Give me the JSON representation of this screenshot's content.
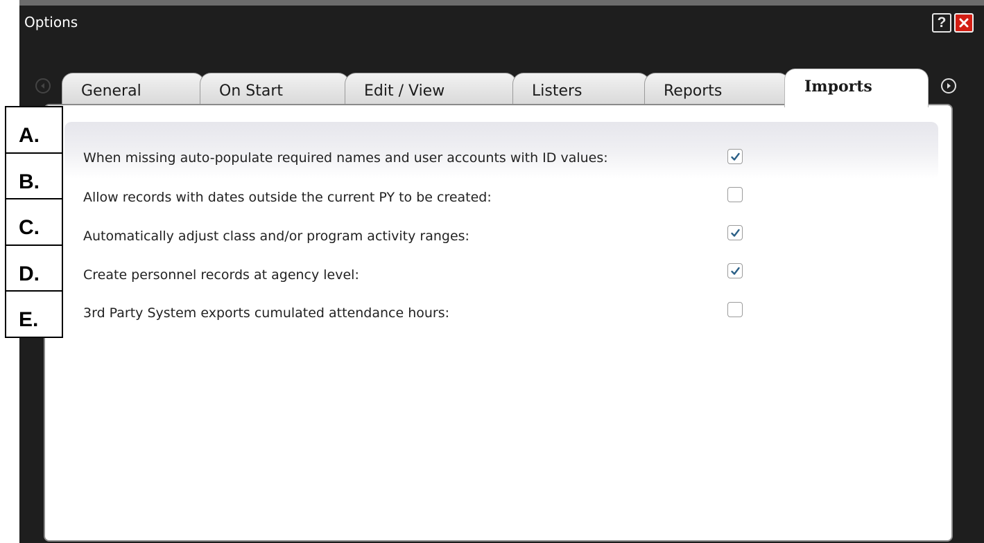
{
  "window": {
    "title": "Options",
    "help_label": "?"
  },
  "tabs": [
    {
      "label": "General",
      "active": false
    },
    {
      "label": "On Start",
      "active": false
    },
    {
      "label": "Edit / View",
      "active": false
    },
    {
      "label": "Listers",
      "active": false
    },
    {
      "label": "Reports",
      "active": false
    },
    {
      "label": "Imports",
      "active": true
    }
  ],
  "options": [
    {
      "letter": "A.",
      "label": "When missing auto-populate required names and user accounts with ID values:",
      "checked": true
    },
    {
      "letter": "B.",
      "label": "Allow records with dates outside the current PY to be created:",
      "checked": false
    },
    {
      "letter": "C.",
      "label": "Automatically adjust class and/or program activity ranges:",
      "checked": true
    },
    {
      "letter": "D.",
      "label": "Create personnel records at agency level:",
      "checked": true
    },
    {
      "letter": "E.",
      "label": "3rd Party System exports cumulated attendance hours:",
      "checked": false
    }
  ],
  "colors": {
    "window_bg": "#1e1e1e",
    "close_red": "#d21e14",
    "check_blue": "#2a5f86"
  },
  "icons": {
    "help": "help-icon",
    "close": "close-icon",
    "prev": "arrow-left-icon",
    "next": "arrow-right-icon",
    "check": "checkmark-icon"
  }
}
